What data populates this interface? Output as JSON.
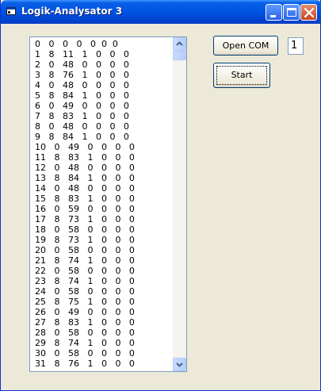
{
  "window": {
    "title": "Logik-Analysator 3"
  },
  "toolbar": {
    "open_com_label": "Open COM",
    "start_label": "Start",
    "com_port_value": "1"
  },
  "list": {
    "rows": [
      "0   0   0   0   0  0  0",
      "1   8   11   1   0   0   0",
      "2   0   48   0   0   0   0",
      "3   8   76   1   0   0   0",
      "4   0   48   0   0   0   0",
      "5   8   84   1   0   0   0",
      "6   0   49   0   0   0   0",
      "7   8   83   1   0   0   0",
      "8   0   48   0   0   0   0",
      "9   8   84   1   0   0   0",
      "10   0   49   0   0   0   0",
      "11   8   83   1   0   0   0",
      "12   0   48   0   0   0   0",
      "13   8   84   1   0   0   0",
      "14   0   48   0   0   0   0",
      "15   8   83   1   0   0   0",
      "16   0   59   0   0   0   0",
      "17   8   73   1   0   0   0",
      "18   0   58   0   0   0   0",
      "19   8   73   1   0   0   0",
      "20   0   58   0   0   0   0",
      "21   8   74   1   0   0   0",
      "22   0   58   0   0   0   0",
      "23   8   74   1   0   0   0",
      "24   0   58   0   0   0   0",
      "25   8   75   1   0   0   0",
      "26   0   49   0   0   0   0",
      "27   8   83   1   0   0   0",
      "28   0   58   0   0   0   0",
      "29   8   74   1   0   0   0",
      "30   0   58   0   0   0   0",
      "31   8   76   1   0   0   0"
    ]
  },
  "icons": {
    "app": "app-icon",
    "minimize": "minimize-icon",
    "maximize": "maximize-icon",
    "close": "close-icon",
    "scroll_up": "chevron-up-icon",
    "scroll_down": "chevron-down-icon"
  },
  "colors": {
    "titlebar": "#0055e5",
    "window_bg": "#ece9d8",
    "close_button": "#c74a23"
  }
}
